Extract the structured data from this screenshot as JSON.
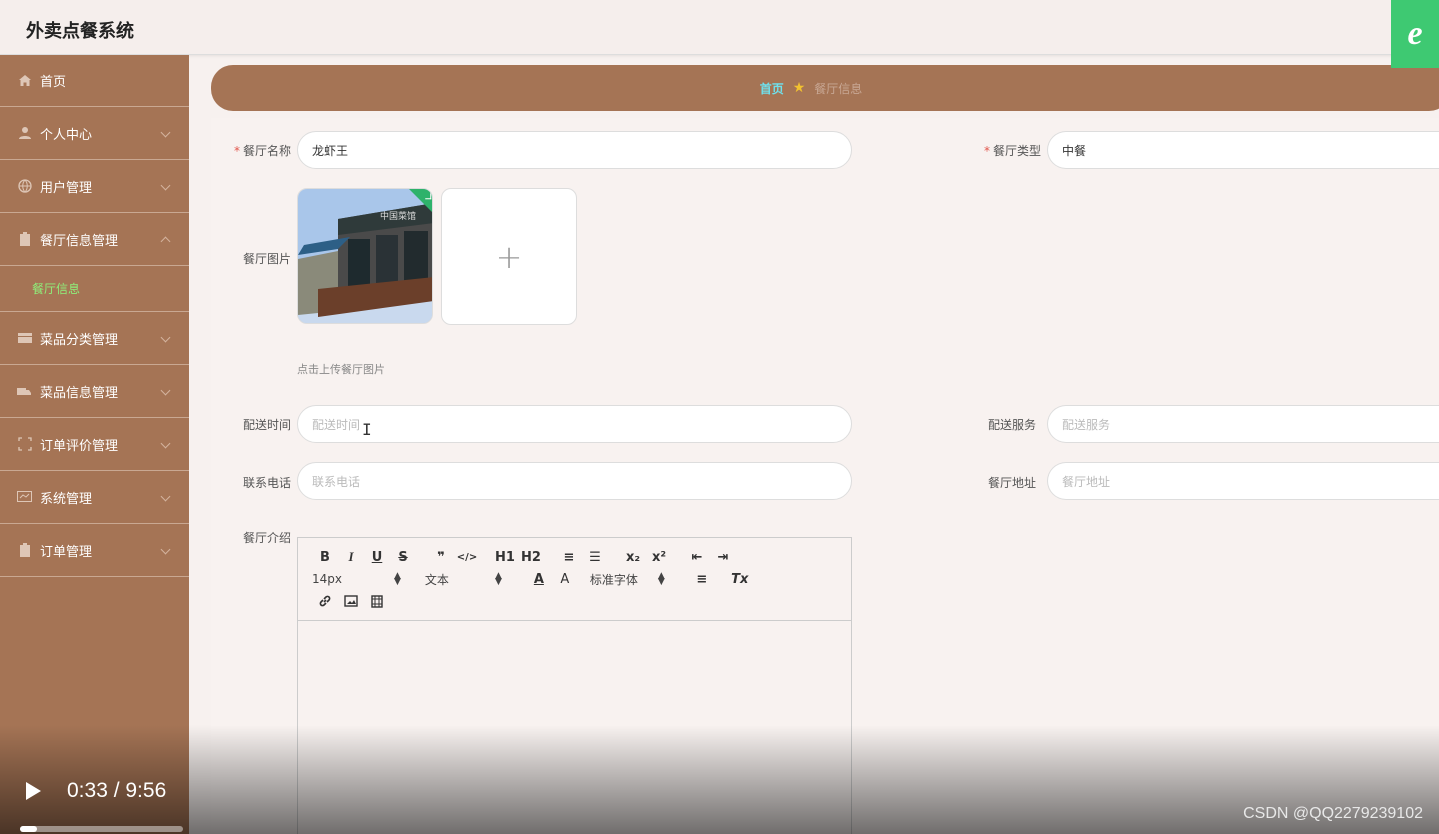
{
  "header": {
    "title": "外卖点餐系统",
    "browser_icon": "e"
  },
  "sidebar": {
    "items": [
      {
        "label": "首页",
        "icon": "home-icon"
      },
      {
        "label": "个人中心",
        "icon": "user-icon"
      },
      {
        "label": "用户管理",
        "icon": "globe-icon"
      },
      {
        "label": "餐厅信息管理",
        "icon": "clipboard-icon",
        "expanded": true
      },
      {
        "label": "菜品分类管理",
        "icon": "box-icon"
      },
      {
        "label": "菜品信息管理",
        "icon": "truck-icon"
      },
      {
        "label": "订单评价管理",
        "icon": "frame-icon"
      },
      {
        "label": "系统管理",
        "icon": "monitor-icon"
      },
      {
        "label": "订单管理",
        "icon": "clipboard-icon"
      }
    ],
    "sub_item": "餐厅信息"
  },
  "breadcrumb": {
    "home": "首页",
    "separator": "★",
    "current": "餐厅信息"
  },
  "form": {
    "name_label": "餐厅名称",
    "name_value": "龙虾王",
    "type_label": "餐厅类型",
    "type_value": "中餐",
    "image_label": "餐厅图片",
    "upload_plus": "+",
    "upload_hint": "点击上传餐厅图片",
    "delivery_time_label": "配送时间",
    "delivery_time_placeholder": "配送时间",
    "delivery_service_label": "配送服务",
    "delivery_service_placeholder": "配送服务",
    "phone_label": "联系电话",
    "phone_placeholder": "联系电话",
    "address_label": "餐厅地址",
    "address_placeholder": "餐厅地址",
    "intro_label": "餐厅介绍",
    "required_mark": "*"
  },
  "editor": {
    "buttons_row1": [
      "B",
      "I",
      "U",
      "S",
      "❞",
      "</>",
      "H1",
      "H2",
      "≡",
      "☰",
      "x₂",
      "x²",
      "⇤",
      "⇥"
    ],
    "font_size": "14px",
    "text_style": "文本",
    "font_family": "标准字体",
    "color_btn": "A",
    "bg_btn": "A",
    "align_btn": "≡",
    "clear_btn": "Tx",
    "row3": [
      "link-icon",
      "image-icon",
      "video-icon"
    ]
  },
  "video": {
    "time": "0:33 / 9:56",
    "progress": 0.06
  },
  "watermark": "CSDN @QQ2279239102",
  "colors": {
    "sidebar": "#a57455",
    "accent": "#6fe0ec",
    "active_sub": "#8ef07a"
  }
}
